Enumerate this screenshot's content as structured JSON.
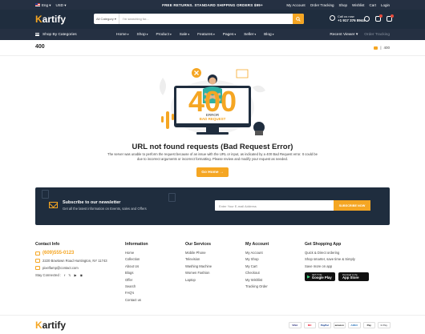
{
  "topbar": {
    "language": "Eng",
    "currency": "USD",
    "promo": "FREE RETURNS. STANDARD SHIPPING ORDERS $99+",
    "links": [
      "My Account",
      "Order Tracking",
      "Shop",
      "Wishlist",
      "Cart",
      "Login"
    ]
  },
  "header": {
    "logo_k": "K",
    "logo_rest": "artify",
    "search_category": "All Category",
    "search_placeholder": "I'm searching for...",
    "call_label": "Call us now",
    "call_number": "+1 917 376 8944",
    "wishlist_count": "0",
    "cart_count": "0"
  },
  "nav": {
    "shop_categories": "Shop By Categories",
    "items": [
      "Home",
      "Shop",
      "Product",
      "Sale",
      "Features",
      "Pages",
      "Seller",
      "Blog"
    ],
    "recent": "Recent Viewer",
    "order_tracking": "Order Tracking"
  },
  "breadcrumb": {
    "title": "400",
    "current": "400"
  },
  "illustration": {
    "big_code": "400",
    "screen_line1": "ERROR",
    "screen_line2": "BAD REQUEST"
  },
  "error": {
    "title": "URL not found requests (Bad Request Error)",
    "description": "The server was unable to perform the request because of an issue with the URL or input, as indicated by a 400 Bad Request error. It could be due to incorrect arguments or incorrect formatting. Please review and modify your request as needed.",
    "button": "Go Home →"
  },
  "newsletter": {
    "title": "Subscribe to our newsletter",
    "subtitle": "Get all the latest information on Events, sales and Offers",
    "placeholder": "Enter Your E-mail Address",
    "button": "SUBSCRIBE NOW"
  },
  "footer": {
    "contact": {
      "heading": "Contact Info",
      "phone": "(609)555-0123",
      "address": "2220 Bowtown Road Huntington, NY 11743",
      "email": "pixelfamp@contact.com",
      "stay_connected": "Stay Connected :"
    },
    "information": {
      "heading": "Information",
      "links": [
        "Home",
        "Collection",
        "About Us",
        "Blogs",
        "Offer",
        "Search",
        "FAQ's",
        "Contact us"
      ]
    },
    "services": {
      "heading": "Our Services",
      "links": [
        "Mobile Phone",
        "Television",
        "Washing Machine",
        "Women Fashion",
        "Laptop"
      ]
    },
    "account": {
      "heading": "My Account",
      "links": [
        "My Account",
        "My Shop",
        "My Cart",
        "Checkout",
        "My Wishlist",
        "Tracking Order"
      ]
    },
    "app": {
      "heading": "Get Shopping App",
      "lines": [
        "Quick & Direct ordering",
        "Shop smarter, save time & Simply",
        "Save more on app"
      ],
      "google_small": "GET IT ON",
      "google_big": "Google Play",
      "apple_small": "Download on the",
      "apple_big": "App Store"
    },
    "payments": [
      "VISA",
      "MC",
      "PayPal",
      "amazon",
      "AMEX",
      "Pay",
      "G Pay"
    ]
  }
}
